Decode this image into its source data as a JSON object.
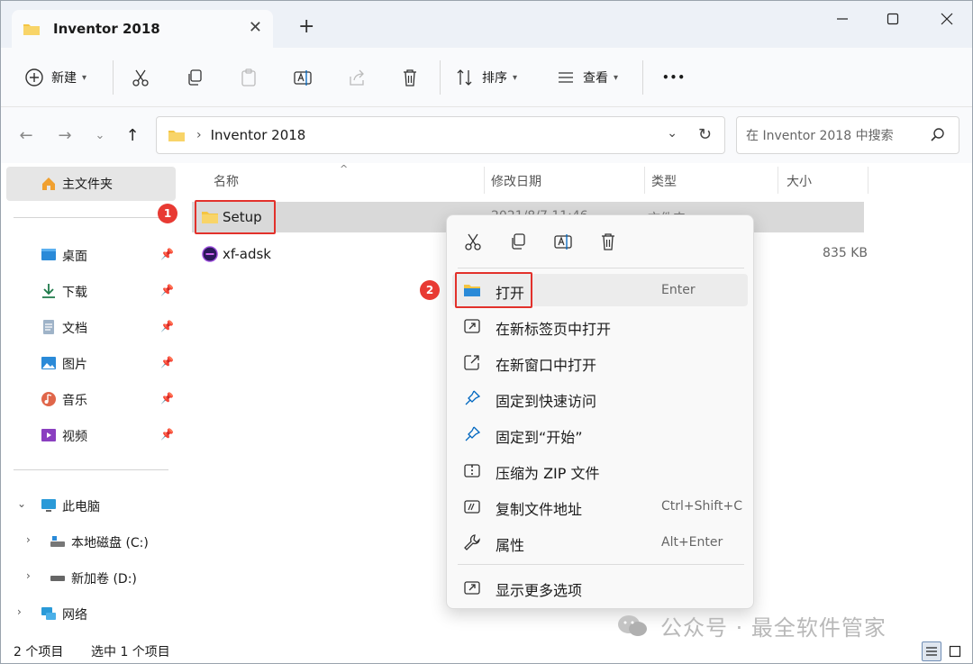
{
  "window": {
    "tab_title": "Inventor 2018",
    "new_tab": "+"
  },
  "toolbar": {
    "new_label": "新建",
    "sort_label": "排序",
    "view_label": "查看",
    "more": "•••"
  },
  "address": {
    "path": "Inventor 2018",
    "separator": "›",
    "search_placeholder": "在 Inventor 2018 中搜索"
  },
  "sidebar": {
    "home": "主文件夹",
    "quick": [
      {
        "label": "桌面"
      },
      {
        "label": "下载"
      },
      {
        "label": "文档"
      },
      {
        "label": "图片"
      },
      {
        "label": "音乐"
      },
      {
        "label": "视频"
      }
    ],
    "this_pc": "此电脑",
    "drives": [
      {
        "label": "本地磁盘 (C:)"
      },
      {
        "label": "新加卷 (D:)"
      }
    ],
    "network": "网络"
  },
  "columns": {
    "name": "名称",
    "date": "修改日期",
    "type": "类型",
    "size": "大小"
  },
  "files": [
    {
      "name": "Setup",
      "date": "2021/8/7 11:46",
      "type": "文件夹",
      "size": ""
    },
    {
      "name": "xf-adsk",
      "date": "",
      "type": "",
      "size": "835 KB"
    }
  ],
  "badges": {
    "one": "1",
    "two": "2"
  },
  "context_menu": {
    "items": [
      {
        "label": "打开",
        "key": "Enter"
      },
      {
        "label": "在新标签页中打开",
        "key": ""
      },
      {
        "label": "在新窗口中打开",
        "key": ""
      },
      {
        "label": "固定到快速访问",
        "key": ""
      },
      {
        "label": "固定到“开始”",
        "key": ""
      },
      {
        "label": "压缩为 ZIP 文件",
        "key": ""
      },
      {
        "label": "复制文件地址",
        "key": "Ctrl+Shift+C"
      },
      {
        "label": "属性",
        "key": "Alt+Enter"
      }
    ],
    "more_options": "显示更多选项"
  },
  "status": {
    "count": "2 个项目",
    "selected": "选中 1 个项目"
  },
  "watermark": "公众号 · 最全软件管家",
  "colors": {
    "accent": "#0067c0",
    "highlight": "#e2312b",
    "folder": "#f4c542"
  }
}
